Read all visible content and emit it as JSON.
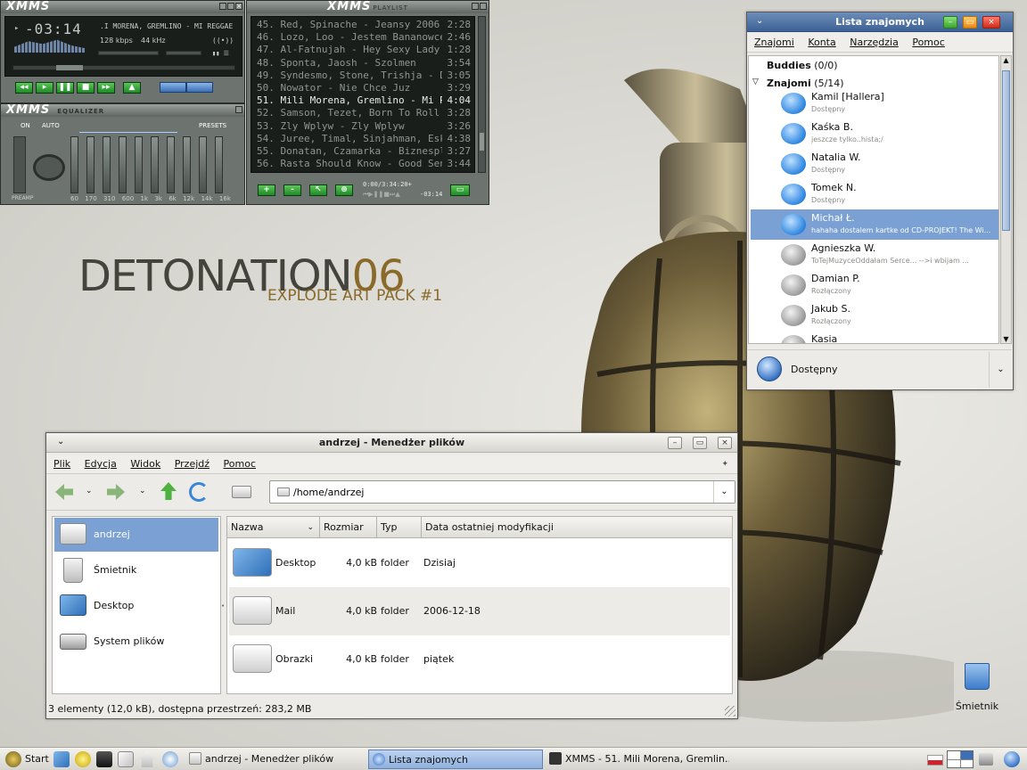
{
  "xmms": {
    "logo": "XMMS",
    "time": "-03:14",
    "song": ".I MORENA, GREMLINO - MI REGGAE",
    "kbps": "128",
    "kbps_unit": "kbps",
    "khz": "44",
    "khz_unit": "kHz",
    "eq_title": "EQUALIZER",
    "eq_on": "ON",
    "eq_auto": "AUTO",
    "eq_presets": "PRESETS",
    "eq_preamp": "PREAMP",
    "eq_bands": [
      "60",
      "170",
      "310",
      "600",
      "1k",
      "3k",
      "6k",
      "12k",
      "14k",
      "16k"
    ],
    "playlist_title": "PLAYLIST",
    "playlist": [
      {
        "t": "45. Red, Spinache - Jeansy 2006",
        "d": "2:28"
      },
      {
        "t": "46. Lozo, Loo - Jestem Bananowcem",
        "d": "2:46"
      },
      {
        "t": "47. Al-Fatnujah - Hey Sexy Lady ...",
        "d": "1:28"
      },
      {
        "t": "48. Sponta, Jaosh - Szolmen",
        "d": "3:54"
      },
      {
        "t": "49. Syndesmo, Stone, Trishja - D...",
        "d": "3:05"
      },
      {
        "t": "50. Nowator - Nie Chce Juz",
        "d": "3:29"
      },
      {
        "t": "51. Mili Morena, Gremlino - Mi R...",
        "d": "4:04"
      },
      {
        "t": "52. Samson, Tezet, Born To Roll ...",
        "d": "3:28"
      },
      {
        "t": "53. Zly Wplyw - Zly Wplyw",
        "d": "3:26"
      },
      {
        "t": "54. Juree, Timal, Sinjahman, Esk...",
        "d": "4:38"
      },
      {
        "t": "55. Donatan, Czamarka - Biznesplan",
        "d": "3:27"
      },
      {
        "t": "56. Rasta Should Know - Good Sensi",
        "d": "3:44"
      }
    ],
    "current_index": 6,
    "pl_time": "0:00/3:34:20+",
    "pl_remain": "-03:14",
    "pl_buttons": [
      "+",
      "-",
      "↖",
      "⊛"
    ]
  },
  "desktop": {
    "title_main": "DETONATION",
    "title_num": "06",
    "subtitle": "EXPLODE ART PACK #1",
    "trash_label": "Śmietnik"
  },
  "buddy_window": {
    "title": "Lista znajomych",
    "menu": [
      "Znajomi",
      "Konta",
      "Narzędzia",
      "Pomoc"
    ],
    "group1": "Buddies",
    "group1_count": "(0/0)",
    "group2": "Znajomi",
    "group2_count": "(5/14)",
    "buddies": [
      {
        "name": "Kamil [Hallera]",
        "status": "Dostępny",
        "online": true
      },
      {
        "name": "Kaśka B.",
        "status": "jeszcze tylko..hista;/",
        "online": true
      },
      {
        "name": "Natalia W.",
        "status": "Dostępny",
        "online": true
      },
      {
        "name": "Tomek N.",
        "status": "Dostępny",
        "online": true
      },
      {
        "name": "Michał Ł.",
        "status": "hahaha dostalem kartke od CD-PROJEKT! The Wi...",
        "online": true
      },
      {
        "name": "Agnieszka W.",
        "status": "ToTejMuzyceOddałam Serce...          -->i wbijam ...",
        "online": false
      },
      {
        "name": "Damian P.",
        "status": "Rozłączony",
        "online": false
      },
      {
        "name": "Jakub S.",
        "status": "Rozłączony",
        "online": false
      },
      {
        "name": "Kasia",
        "status": "",
        "online": false
      }
    ],
    "selected_index": 4,
    "status_label": "Dostępny"
  },
  "file_manager": {
    "title": "andrzej - Menedżer plików",
    "menu": [
      "Plik",
      "Edycja",
      "Widok",
      "Przejdź",
      "Pomoc"
    ],
    "location": "/home/andrzej",
    "sidebar": [
      "andrzej",
      "Śmietnik",
      "Desktop",
      "System plików"
    ],
    "columns": [
      "Nazwa",
      "Rozmiar",
      "Typ",
      "Data ostatniej modyfikacji"
    ],
    "rows": [
      {
        "name": "Desktop",
        "size": "4,0 kB",
        "type": "folder",
        "date": "Dzisiaj"
      },
      {
        "name": "Mail",
        "size": "4,0 kB",
        "type": "folder",
        "date": "2006-12-18"
      },
      {
        "name": "Obrazki",
        "size": "4,0 kB",
        "type": "folder",
        "date": "piątek"
      }
    ],
    "statusbar": "3 elementy (12,0 kB), dostępna przestrzeń: 283,2 MB"
  },
  "taskbar": {
    "start": "Start",
    "tasks": [
      {
        "label": "andrzej - Menedżer plików",
        "active": false
      },
      {
        "label": "Lista znajomych",
        "active": true
      },
      {
        "label": "XMMS - 51. Mili Morena, Gremlin...",
        "active": false
      }
    ]
  }
}
